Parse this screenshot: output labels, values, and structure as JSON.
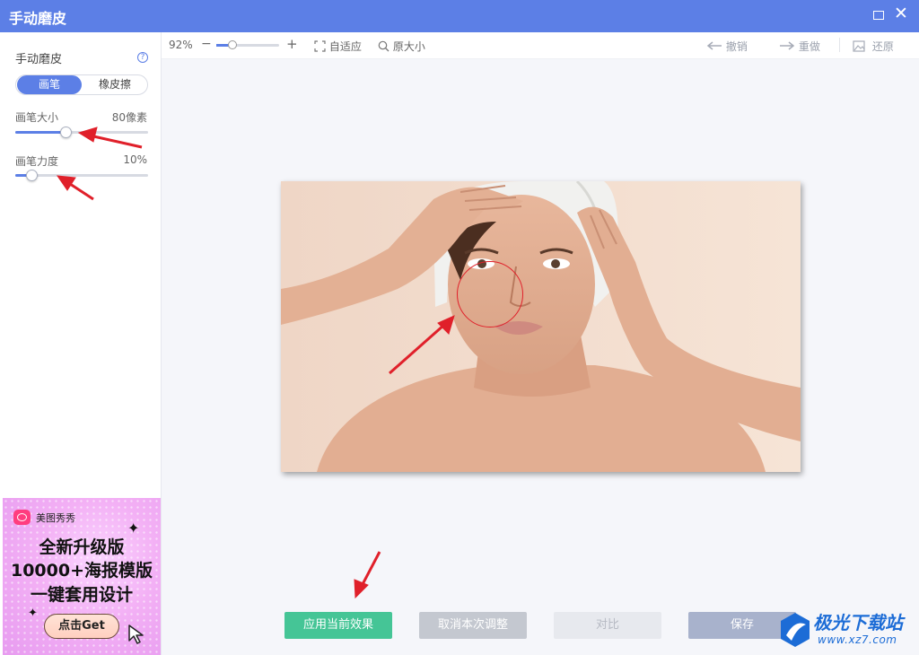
{
  "window": {
    "title": "手动磨皮",
    "maximize_icon": "maximize-icon",
    "close_icon": "close-icon",
    "close_glyph": "✕"
  },
  "sidebar": {
    "heading": "手动磨皮",
    "help_glyph": "?",
    "mode_options": [
      "画笔",
      "橡皮擦"
    ],
    "mode_selected": "画笔",
    "brush_size": {
      "label": "画笔大小",
      "value_text": "80像素",
      "level": 0.38
    },
    "brush_strength": {
      "label": "画笔力度",
      "value_text": "10%",
      "level": 0.12
    }
  },
  "toolbar": {
    "zoom_text": "92%",
    "zoom_level": 0.25,
    "zoom_out_glyph": "−",
    "zoom_in_glyph": "+",
    "fit_label": "自适应",
    "original_size_label": "原大小",
    "undo_label": "撤销",
    "redo_label": "重做",
    "restore_label": "还原"
  },
  "actions": {
    "apply": "应用当前效果",
    "cancel": "取消本次调整",
    "compare": "对比",
    "save": "保存"
  },
  "ad": {
    "brand": "美图秀秀",
    "line1": "全新升级版",
    "line2": "10000+海报模版",
    "line3": "一键套用设计",
    "cta": "点击Get"
  },
  "watermark": {
    "title": "极光下载站",
    "url": "www.xz7.com"
  },
  "colors": {
    "accent": "#5c7fe6",
    "apply_green": "#45c596",
    "annotation_red": "#e0202a"
  }
}
